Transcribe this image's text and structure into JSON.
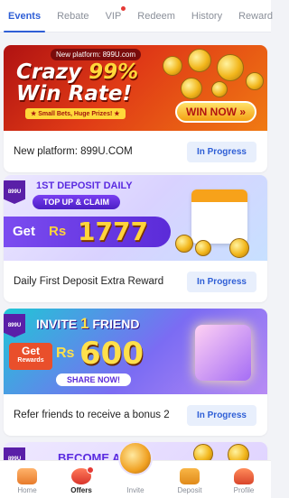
{
  "tabs": [
    {
      "label": "Events",
      "active": true,
      "dot": false
    },
    {
      "label": "Rebate",
      "active": false,
      "dot": false
    },
    {
      "label": "VIP",
      "active": false,
      "dot": true
    },
    {
      "label": "Redeem",
      "active": false,
      "dot": false
    },
    {
      "label": "History",
      "active": false,
      "dot": false
    },
    {
      "label": "Reward",
      "active": false,
      "dot": false
    }
  ],
  "cards": [
    {
      "title": "New platform: 899U.COM",
      "status": "In Progress",
      "banner": {
        "tagline": "New platform: 899U.com",
        "headline_1": "Crazy ",
        "headline_pct": "99%",
        "headline_2": "Win Rate!",
        "subline": "★ Small Bets, Huge Prizes! ★",
        "cta": "WIN NOW »"
      }
    },
    {
      "title": "Daily First Deposit Extra Reward",
      "status": "In Progress",
      "banner": {
        "badge": "899U",
        "headline": "1ST DEPOSIT DAILY",
        "pill": "TOP UP & CLAIM",
        "get": "Get",
        "currency": "Rs",
        "amount": "1777"
      }
    },
    {
      "title": "Refer friends to receive a bonus 2",
      "status": "In Progress",
      "banner": {
        "badge": "899U",
        "headline_a": "INVITE ",
        "headline_num": "1",
        "headline_b": " FRIEND",
        "get": "Get",
        "rewards": "Rewards",
        "currency": "Rs",
        "amount": "600",
        "cta": "SHARE NOW!"
      }
    },
    {
      "banner": {
        "badge": "899U",
        "headline": "BECOME AN A"
      }
    }
  ],
  "nav": [
    {
      "label": "Home",
      "icon": "home-icon",
      "active": false
    },
    {
      "label": "Offers",
      "icon": "offers-icon",
      "active": true
    },
    {
      "label": "Invite",
      "icon": "invite-icon",
      "active": false
    },
    {
      "label": "Deposit",
      "icon": "deposit-icon",
      "active": false
    },
    {
      "label": "Profile",
      "icon": "profile-icon",
      "active": false
    }
  ],
  "colors": {
    "accent": "#2f5fd6",
    "status_bg": "#e8effc",
    "page_bg": "#f2f3f7"
  }
}
